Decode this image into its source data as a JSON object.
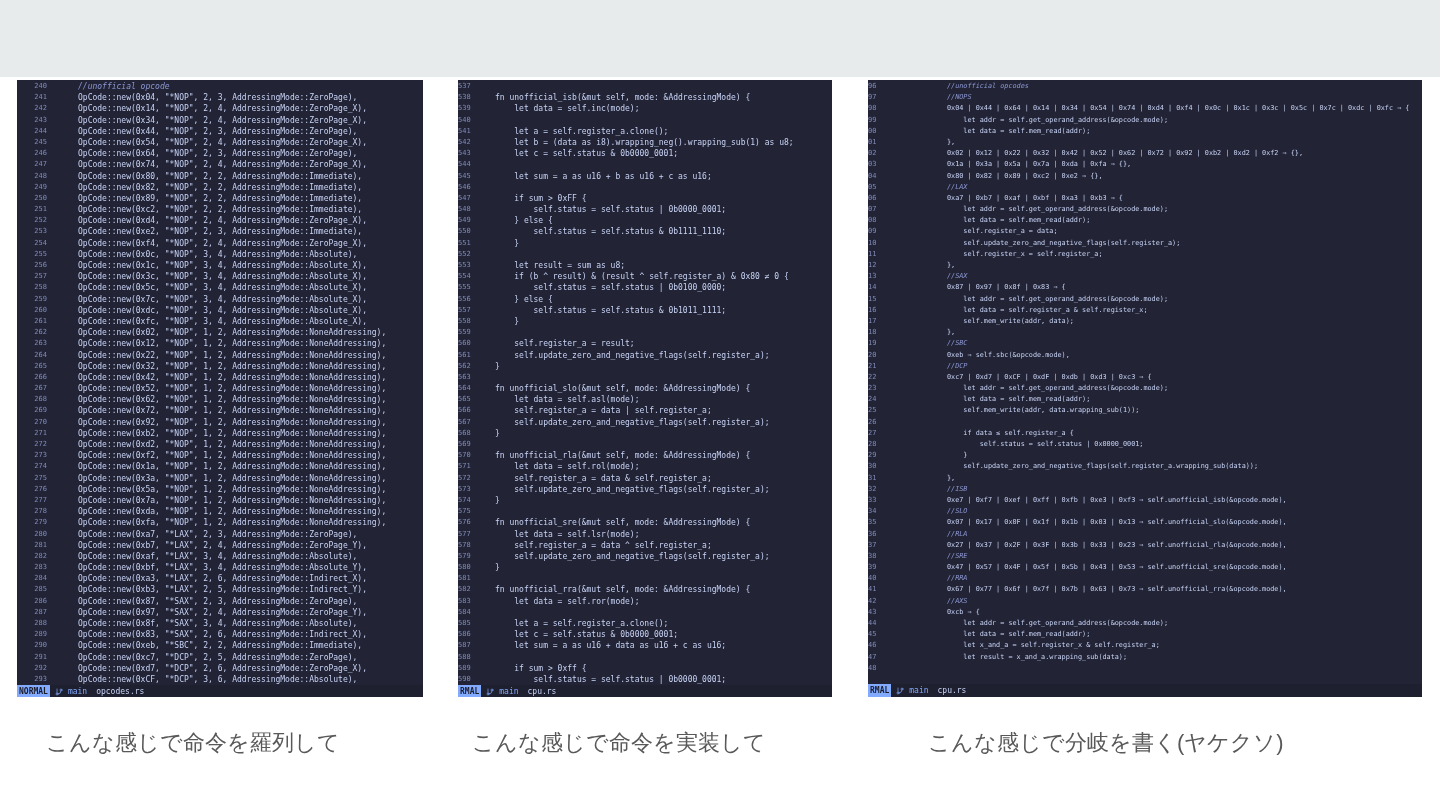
{
  "panels": [
    {
      "lines": [
        {
          "n": "240",
          "kind": "comment",
          "text": "//unofficial opcode"
        },
        {
          "n": "241",
          "kind": "code",
          "text": "OpCode::new(0x04, \"*NOP\", 2, 3, AddressingMode::ZeroPage),"
        },
        {
          "n": "242",
          "kind": "code",
          "text": "OpCode::new(0x14, \"*NOP\", 2, 4, AddressingMode::ZeroPage_X),"
        },
        {
          "n": "243",
          "kind": "code",
          "text": "OpCode::new(0x34, \"*NOP\", 2, 4, AddressingMode::ZeroPage_X),"
        },
        {
          "n": "244",
          "kind": "code",
          "text": "OpCode::new(0x44, \"*NOP\", 2, 3, AddressingMode::ZeroPage),"
        },
        {
          "n": "245",
          "kind": "code",
          "text": "OpCode::new(0x54, \"*NOP\", 2, 4, AddressingMode::ZeroPage_X),"
        },
        {
          "n": "246",
          "kind": "code",
          "text": "OpCode::new(0x64, \"*NOP\", 2, 3, AddressingMode::ZeroPage),"
        },
        {
          "n": "247",
          "kind": "code",
          "text": "OpCode::new(0x74, \"*NOP\", 2, 4, AddressingMode::ZeroPage_X),"
        },
        {
          "n": "248",
          "kind": "code",
          "text": "OpCode::new(0x80, \"*NOP\", 2, 2, AddressingMode::Immediate),"
        },
        {
          "n": "249",
          "kind": "code",
          "text": "OpCode::new(0x82, \"*NOP\", 2, 2, AddressingMode::Immediate),"
        },
        {
          "n": "250",
          "kind": "code",
          "text": "OpCode::new(0x89, \"*NOP\", 2, 2, AddressingMode::Immediate),"
        },
        {
          "n": "251",
          "kind": "code",
          "text": "OpCode::new(0xc2, \"*NOP\", 2, 2, AddressingMode::Immediate),"
        },
        {
          "n": "252",
          "kind": "code",
          "text": "OpCode::new(0xd4, \"*NOP\", 2, 4, AddressingMode::ZeroPage_X),"
        },
        {
          "n": "253",
          "kind": "code",
          "text": "OpCode::new(0xe2, \"*NOP\", 2, 3, AddressingMode::Immediate),"
        },
        {
          "n": "254",
          "kind": "code",
          "text": "OpCode::new(0xf4, \"*NOP\", 2, 4, AddressingMode::ZeroPage_X),"
        },
        {
          "n": "255",
          "kind": "code",
          "text": "OpCode::new(0x0c, \"*NOP\", 3, 4, AddressingMode::Absolute),"
        },
        {
          "n": "256",
          "kind": "code",
          "text": "OpCode::new(0x1c, \"*NOP\", 3, 4, AddressingMode::Absolute_X),"
        },
        {
          "n": "257",
          "kind": "code",
          "text": "OpCode::new(0x3c, \"*NOP\", 3, 4, AddressingMode::Absolute_X),"
        },
        {
          "n": "258",
          "kind": "code",
          "text": "OpCode::new(0x5c, \"*NOP\", 3, 4, AddressingMode::Absolute_X),"
        },
        {
          "n": "259",
          "kind": "code",
          "text": "OpCode::new(0x7c, \"*NOP\", 3, 4, AddressingMode::Absolute_X),"
        },
        {
          "n": "260",
          "kind": "code",
          "text": "OpCode::new(0xdc, \"*NOP\", 3, 4, AddressingMode::Absolute_X),"
        },
        {
          "n": "261",
          "kind": "code",
          "text": "OpCode::new(0xfc, \"*NOP\", 3, 4, AddressingMode::Absolute_X),"
        },
        {
          "n": "262",
          "kind": "code",
          "text": "OpCode::new(0x02, \"*NOP\", 1, 2, AddressingMode::NoneAddressing),"
        },
        {
          "n": "263",
          "kind": "code",
          "text": "OpCode::new(0x12, \"*NOP\", 1, 2, AddressingMode::NoneAddressing),"
        },
        {
          "n": "264",
          "kind": "code",
          "text": "OpCode::new(0x22, \"*NOP\", 1, 2, AddressingMode::NoneAddressing),"
        },
        {
          "n": "265",
          "kind": "code",
          "text": "OpCode::new(0x32, \"*NOP\", 1, 2, AddressingMode::NoneAddressing),"
        },
        {
          "n": "266",
          "kind": "code",
          "text": "OpCode::new(0x42, \"*NOP\", 1, 2, AddressingMode::NoneAddressing),"
        },
        {
          "n": "267",
          "kind": "code",
          "text": "OpCode::new(0x52, \"*NOP\", 1, 2, AddressingMode::NoneAddressing),"
        },
        {
          "n": "268",
          "kind": "code",
          "text": "OpCode::new(0x62, \"*NOP\", 1, 2, AddressingMode::NoneAddressing),"
        },
        {
          "n": "269",
          "kind": "code",
          "text": "OpCode::new(0x72, \"*NOP\", 1, 2, AddressingMode::NoneAddressing),"
        },
        {
          "n": "270",
          "kind": "code",
          "text": "OpCode::new(0x92, \"*NOP\", 1, 2, AddressingMode::NoneAddressing),"
        },
        {
          "n": "271",
          "kind": "code",
          "text": "OpCode::new(0xb2, \"*NOP\", 1, 2, AddressingMode::NoneAddressing),"
        },
        {
          "n": "272",
          "kind": "code",
          "text": "OpCode::new(0xd2, \"*NOP\", 1, 2, AddressingMode::NoneAddressing),"
        },
        {
          "n": "273",
          "kind": "code",
          "text": "OpCode::new(0xf2, \"*NOP\", 1, 2, AddressingMode::NoneAddressing),"
        },
        {
          "n": "274",
          "kind": "code",
          "text": "OpCode::new(0x1a, \"*NOP\", 1, 2, AddressingMode::NoneAddressing),"
        },
        {
          "n": "275",
          "kind": "code",
          "text": "OpCode::new(0x3a, \"*NOP\", 1, 2, AddressingMode::NoneAddressing),"
        },
        {
          "n": "276",
          "kind": "code",
          "text": "OpCode::new(0x5a, \"*NOP\", 1, 2, AddressingMode::NoneAddressing),"
        },
        {
          "n": "277",
          "kind": "code",
          "text": "OpCode::new(0x7a, \"*NOP\", 1, 2, AddressingMode::NoneAddressing),"
        },
        {
          "n": "278",
          "kind": "code",
          "text": "OpCode::new(0xda, \"*NOP\", 1, 2, AddressingMode::NoneAddressing),"
        },
        {
          "n": "279",
          "kind": "code",
          "text": "OpCode::new(0xfa, \"*NOP\", 1, 2, AddressingMode::NoneAddressing),"
        },
        {
          "n": "280",
          "kind": "code",
          "text": "OpCode::new(0xa7, \"*LAX\", 2, 3, AddressingMode::ZeroPage),"
        },
        {
          "n": "281",
          "kind": "code",
          "text": "OpCode::new(0xb7, \"*LAX\", 2, 4, AddressingMode::ZeroPage_Y),"
        },
        {
          "n": "282",
          "kind": "code",
          "text": "OpCode::new(0xaf, \"*LAX\", 3, 4, AddressingMode::Absolute),"
        },
        {
          "n": "283",
          "kind": "code",
          "text": "OpCode::new(0xbf, \"*LAX\", 3, 4, AddressingMode::Absolute_Y),"
        },
        {
          "n": "284",
          "kind": "code",
          "text": "OpCode::new(0xa3, \"*LAX\", 2, 6, AddressingMode::Indirect_X),"
        },
        {
          "n": "285",
          "kind": "code",
          "text": "OpCode::new(0xb3, \"*LAX\", 2, 5, AddressingMode::Indirect_Y),"
        },
        {
          "n": "286",
          "kind": "code",
          "text": "OpCode::new(0x87, \"*SAX\", 2, 3, AddressingMode::ZeroPage),"
        },
        {
          "n": "287",
          "kind": "code",
          "text": "OpCode::new(0x97, \"*SAX\", 2, 4, AddressingMode::ZeroPage_Y),"
        },
        {
          "n": "288",
          "kind": "code",
          "text": "OpCode::new(0x8f, \"*SAX\", 3, 4, AddressingMode::Absolute),"
        },
        {
          "n": "289",
          "kind": "code",
          "text": "OpCode::new(0x83, \"*SAX\", 2, 6, AddressingMode::Indirect_X),"
        },
        {
          "n": "290",
          "kind": "code",
          "text": "OpCode::new(0xeb, \"*SBC\", 2, 2, AddressingMode::Immediate),"
        },
        {
          "n": "291",
          "kind": "code",
          "text": "OpCode::new(0xc7, \"*DCP\", 2, 5, AddressingMode::ZeroPage),"
        },
        {
          "n": "292",
          "kind": "code",
          "text": "OpCode::new(0xd7, \"*DCP\", 2, 6, AddressingMode::ZeroPage_X),"
        },
        {
          "n": "293",
          "kind": "code",
          "text": "OpCode::new(0xCF, \"*DCP\", 3, 6, AddressingMode::Absolute),"
        }
      ],
      "status_bar": {
        "mode": "NORMAL",
        "branch": "main",
        "file": "opcodes.rs"
      },
      "caption": "こんな感じで命令を羅列して"
    },
    {
      "lines": [
        {
          "n": "537",
          "kind": "blank"
        },
        {
          "n": "538",
          "kind": "code",
          "text": "fn unofficial_isb(&mut self, mode: &AddressingMode) {"
        },
        {
          "n": "539",
          "kind": "code",
          "text": "    let data = self.inc(mode);"
        },
        {
          "n": "540",
          "kind": "blank"
        },
        {
          "n": "541",
          "kind": "code",
          "text": "    let a = self.register_a.clone();"
        },
        {
          "n": "542",
          "kind": "code",
          "text": "    let b = (data as i8).wrapping_neg().wrapping_sub(1) as u8;"
        },
        {
          "n": "543",
          "kind": "code",
          "text": "    let c = self.status & 0b0000_0001;"
        },
        {
          "n": "544",
          "kind": "blank"
        },
        {
          "n": "545",
          "kind": "code",
          "text": "    let sum = a as u16 + b as u16 + c as u16;"
        },
        {
          "n": "546",
          "kind": "blank"
        },
        {
          "n": "547",
          "kind": "code",
          "text": "    if sum > 0xFF {"
        },
        {
          "n": "548",
          "kind": "code",
          "text": "        self.status = self.status | 0b0000_0001;"
        },
        {
          "n": "549",
          "kind": "code",
          "text": "    } else {"
        },
        {
          "n": "550",
          "kind": "code",
          "text": "        self.status = self.status & 0b1111_1110;"
        },
        {
          "n": "551",
          "kind": "code",
          "text": "    }"
        },
        {
          "n": "552",
          "kind": "blank"
        },
        {
          "n": "553",
          "kind": "code",
          "text": "    let result = sum as u8;"
        },
        {
          "n": "554",
          "kind": "code",
          "text": "    if (b ^ result) & (result ^ self.register_a) & 0x80 ≠ 0 {"
        },
        {
          "n": "555",
          "kind": "code",
          "text": "        self.status = self.status | 0b0100_0000;"
        },
        {
          "n": "556",
          "kind": "code",
          "text": "    } else {"
        },
        {
          "n": "557",
          "kind": "code",
          "text": "        self.status = self.status & 0b1011_1111;"
        },
        {
          "n": "558",
          "kind": "code",
          "text": "    }"
        },
        {
          "n": "559",
          "kind": "blank"
        },
        {
          "n": "560",
          "kind": "code",
          "text": "    self.register_a = result;"
        },
        {
          "n": "561",
          "kind": "code",
          "text": "    self.update_zero_and_negative_flags(self.register_a);"
        },
        {
          "n": "562",
          "kind": "code",
          "text": "}"
        },
        {
          "n": "563",
          "kind": "blank"
        },
        {
          "n": "564",
          "kind": "code",
          "text": "fn unofficial_slo(&mut self, mode: &AddressingMode) {"
        },
        {
          "n": "565",
          "kind": "code",
          "text": "    let data = self.asl(mode);"
        },
        {
          "n": "566",
          "kind": "code",
          "text": "    self.register_a = data | self.register_a;"
        },
        {
          "n": "567",
          "kind": "code",
          "text": "    self.update_zero_and_negative_flags(self.register_a);"
        },
        {
          "n": "568",
          "kind": "code",
          "text": "}"
        },
        {
          "n": "569",
          "kind": "blank"
        },
        {
          "n": "570",
          "kind": "code",
          "text": "fn unofficial_rla(&mut self, mode: &AddressingMode) {"
        },
        {
          "n": "571",
          "kind": "code",
          "text": "    let data = self.rol(mode);"
        },
        {
          "n": "572",
          "kind": "code",
          "text": "    self.register_a = data & self.register_a;"
        },
        {
          "n": "573",
          "kind": "code",
          "text": "    self.update_zero_and_negative_flags(self.register_a);"
        },
        {
          "n": "574",
          "kind": "code",
          "text": "}"
        },
        {
          "n": "575",
          "kind": "blank"
        },
        {
          "n": "576",
          "kind": "code",
          "text": "fn unofficial_sre(&mut self, mode: &AddressingMode) {"
        },
        {
          "n": "577",
          "kind": "code",
          "text": "    let data = self.lsr(mode);"
        },
        {
          "n": "578",
          "kind": "code",
          "text": "    self.register_a = data ^ self.register_a;"
        },
        {
          "n": "579",
          "kind": "code",
          "text": "    self.update_zero_and_negative_flags(self.register_a);"
        },
        {
          "n": "580",
          "kind": "code",
          "text": "}"
        },
        {
          "n": "581",
          "kind": "blank"
        },
        {
          "n": "582",
          "kind": "code",
          "text": "fn unofficial_rra(&mut self, mode: &AddressingMode) {"
        },
        {
          "n": "583",
          "kind": "code",
          "text": "    let data = self.ror(mode);"
        },
        {
          "n": "584",
          "kind": "blank"
        },
        {
          "n": "585",
          "kind": "code",
          "text": "    let a = self.register_a.clone();"
        },
        {
          "n": "586",
          "kind": "code",
          "text": "    let c = self.status & 0b0000_0001;"
        },
        {
          "n": "587",
          "kind": "code",
          "text": "    let sum = a as u16 + data as u16 + c as u16;"
        },
        {
          "n": "588",
          "kind": "blank"
        },
        {
          "n": "589",
          "kind": "code",
          "text": "    if sum > 0xff {"
        },
        {
          "n": "590",
          "kind": "code",
          "text": "        self.status = self.status | 0b0000_0001;"
        }
      ],
      "status_bar": {
        "mode": "RMAL",
        "branch": "main",
        "file": "cpu.rs"
      },
      "caption": "こんな感じで命令を実装して"
    },
    {
      "lines": [
        {
          "n": "96",
          "kind": "comment",
          "text": "//unofficial opcodes"
        },
        {
          "n": "97",
          "kind": "comment",
          "text": "//NOPS"
        },
        {
          "n": "98",
          "kind": "code",
          "text": "0x04 | 0x44 | 0x64 | 0x14 | 0x34 | 0x54 | 0x74 | 0xd4 | 0xf4 | 0x0c | 0x1c | 0x3c | 0x5c | 0x7c | 0xdc | 0xfc ⇒ {"
        },
        {
          "n": "99",
          "kind": "code",
          "text": "    let addr = self.get_operand_address(&opcode.mode);"
        },
        {
          "n": "00",
          "kind": "code",
          "text": "    let data = self.mem_read(addr);"
        },
        {
          "n": "01",
          "kind": "code",
          "text": "},"
        },
        {
          "n": "02",
          "kind": "code",
          "text": "0x02 | 0x12 | 0x22 | 0x32 | 0x42 | 0x52 | 0x62 | 0x72 | 0x92 | 0xb2 | 0xd2 | 0xf2 ⇒ {},"
        },
        {
          "n": "03",
          "kind": "code",
          "text": "0x1a | 0x3a | 0x5a | 0x7a | 0xda | 0xfa ⇒ {},"
        },
        {
          "n": "04",
          "kind": "code",
          "text": "0x80 | 0x82 | 0x89 | 0xc2 | 0xe2 ⇒ {},"
        },
        {
          "n": "05",
          "kind": "comment",
          "text": "//LAX"
        },
        {
          "n": "06",
          "kind": "code",
          "text": "0xa7 | 0xb7 | 0xaf | 0xbf | 0xa3 | 0xb3 ⇒ {"
        },
        {
          "n": "07",
          "kind": "code",
          "text": "    let addr = self.get_operand_address(&opcode.mode);"
        },
        {
          "n": "08",
          "kind": "code",
          "text": "    let data = self.mem_read(addr);"
        },
        {
          "n": "09",
          "kind": "code",
          "text": "    self.register_a = data;"
        },
        {
          "n": "10",
          "kind": "code",
          "text": "    self.update_zero_and_negative_flags(self.register_a);"
        },
        {
          "n": "11",
          "kind": "code",
          "text": "    self.register_x = self.register_a;"
        },
        {
          "n": "12",
          "kind": "code",
          "text": "},"
        },
        {
          "n": "13",
          "kind": "comment",
          "text": "//SAX"
        },
        {
          "n": "14",
          "kind": "code",
          "text": "0x87 | 0x97 | 0x8f | 0x83 ⇒ {"
        },
        {
          "n": "15",
          "kind": "code",
          "text": "    let addr = self.get_operand_address(&opcode.mode);"
        },
        {
          "n": "16",
          "kind": "code",
          "text": "    let data = self.register_a & self.register_x;"
        },
        {
          "n": "17",
          "kind": "code",
          "text": "    self.mem_write(addr, data);"
        },
        {
          "n": "18",
          "kind": "code",
          "text": "},"
        },
        {
          "n": "19",
          "kind": "comment",
          "text": "//SBC"
        },
        {
          "n": "20",
          "kind": "code",
          "text": "0xeb ⇒ self.sbc(&opcode.mode),"
        },
        {
          "n": "21",
          "kind": "comment",
          "text": "//DCP"
        },
        {
          "n": "22",
          "kind": "code",
          "text": "0xc7 | 0xd7 | 0xCF | 0xdF | 0xdb | 0xd3 | 0xc3 ⇒ {"
        },
        {
          "n": "23",
          "kind": "code",
          "text": "    let addr = self.get_operand_address(&opcode.mode);"
        },
        {
          "n": "24",
          "kind": "code",
          "text": "    let data = self.mem_read(addr);"
        },
        {
          "n": "25",
          "kind": "code",
          "text": "    self.mem_write(addr, data.wrapping_sub(1));"
        },
        {
          "n": "26",
          "kind": "blank"
        },
        {
          "n": "27",
          "kind": "code",
          "text": "    if data ≤ self.register_a {"
        },
        {
          "n": "28",
          "kind": "code",
          "text": "        self.status = self.status | 0x0000_0001;"
        },
        {
          "n": "29",
          "kind": "code",
          "text": "    }"
        },
        {
          "n": "30",
          "kind": "code",
          "text": "    self.update_zero_and_negative_flags(self.register_a.wrapping_sub(data));"
        },
        {
          "n": "31",
          "kind": "code",
          "text": "},"
        },
        {
          "n": "32",
          "kind": "comment",
          "text": "//ISB"
        },
        {
          "n": "33",
          "kind": "code",
          "text": "0xe7 | 0xf7 | 0xef | 0xff | 0xfb | 0xe3 | 0xf3 ⇒ self.unofficial_isb(&opcode.mode),"
        },
        {
          "n": "34",
          "kind": "comment",
          "text": "//SLO"
        },
        {
          "n": "35",
          "kind": "code",
          "text": "0x07 | 0x17 | 0x0F | 0x1f | 0x1b | 0x03 | 0x13 ⇒ self.unofficial_slo(&opcode.mode),"
        },
        {
          "n": "36",
          "kind": "comment",
          "text": "//RLA"
        },
        {
          "n": "37",
          "kind": "code",
          "text": "0x27 | 0x37 | 0x2F | 0x3F | 0x3b | 0x33 | 0x23 ⇒ self.unofficial_rla(&opcode.mode),"
        },
        {
          "n": "38",
          "kind": "comment",
          "text": "//SRE"
        },
        {
          "n": "39",
          "kind": "code",
          "text": "0x47 | 0x57 | 0x4F | 0x5f | 0x5b | 0x43 | 0x53 ⇒ self.unofficial_sre(&opcode.mode),"
        },
        {
          "n": "40",
          "kind": "comment",
          "text": "//RRA"
        },
        {
          "n": "41",
          "kind": "code",
          "text": "0x67 | 0x77 | 0x6f | 0x7f | 0x7b | 0x63 | 0x73 ⇒ self.unofficial_rra(&opcode.mode),"
        },
        {
          "n": "42",
          "kind": "comment",
          "text": "//AXS"
        },
        {
          "n": "43",
          "kind": "code",
          "text": "0xcb ⇒ {"
        },
        {
          "n": "44",
          "kind": "code",
          "text": "    let addr = self.get_operand_address(&opcode.mode);"
        },
        {
          "n": "45",
          "kind": "code",
          "text": "    let data = self.mem_read(addr);"
        },
        {
          "n": "46",
          "kind": "code",
          "text": "    let x_and_a = self.register_x & self.register_a;"
        },
        {
          "n": "47",
          "kind": "code",
          "text": "    let result = x_and_a.wrapping_sub(data);"
        },
        {
          "n": "48",
          "kind": "blank"
        }
      ],
      "status_bar": {
        "mode": "RMAL",
        "branch": "main",
        "file": "cpu.rs"
      },
      "caption": "こんな感じで分岐を書く(ヤケクソ)"
    }
  ]
}
